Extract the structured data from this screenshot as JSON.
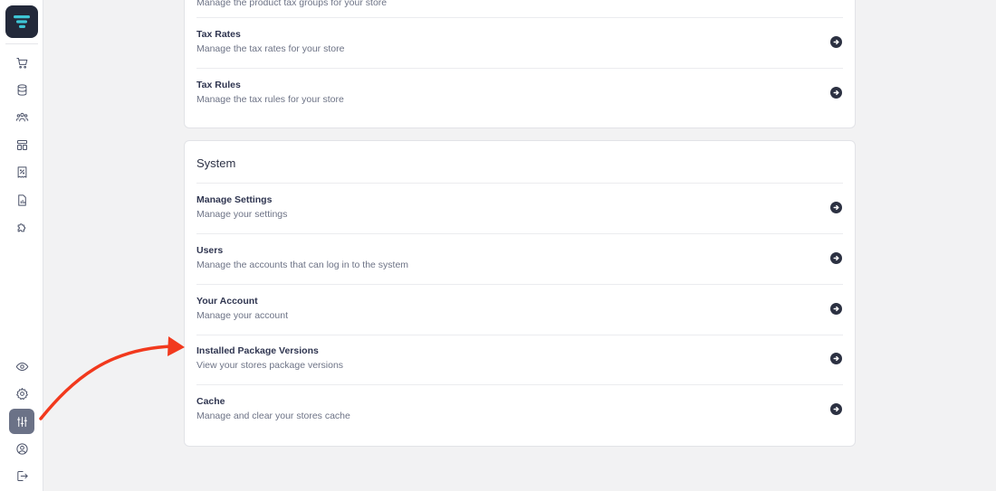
{
  "app": {
    "logo_icon": "stacked-bars-logo-icon",
    "accent": "#3ec6d6"
  },
  "sidebar": {
    "items": [
      {
        "name": "cart-icon"
      },
      {
        "name": "database-icon"
      },
      {
        "name": "users-group-icon"
      },
      {
        "name": "layout-icon"
      },
      {
        "name": "receipt-tax-icon"
      },
      {
        "name": "report-icon"
      },
      {
        "name": "puzzle-icon"
      },
      {
        "name": "eye-icon"
      },
      {
        "name": "gear-icon"
      },
      {
        "name": "sliders-icon",
        "active": true
      },
      {
        "name": "user-circle-icon"
      },
      {
        "name": "logout-icon"
      }
    ]
  },
  "tax_section": {
    "partial_desc": "Manage the product tax groups for your store",
    "rows": [
      {
        "title": "Tax Rates",
        "desc": "Manage the tax rates for your store"
      },
      {
        "title": "Tax Rules",
        "desc": "Manage the tax rules for your store"
      }
    ]
  },
  "system_section": {
    "title": "System",
    "rows": [
      {
        "title": "Manage Settings",
        "desc": "Manage your settings"
      },
      {
        "title": "Users",
        "desc": "Manage the accounts that can log in to the system"
      },
      {
        "title": "Your Account",
        "desc": "Manage your account"
      },
      {
        "title": "Installed Package Versions",
        "desc": "View your stores package versions"
      },
      {
        "title": "Cache",
        "desc": "Manage and clear your stores cache"
      }
    ]
  },
  "annotation": {
    "color": "#f2391d"
  }
}
